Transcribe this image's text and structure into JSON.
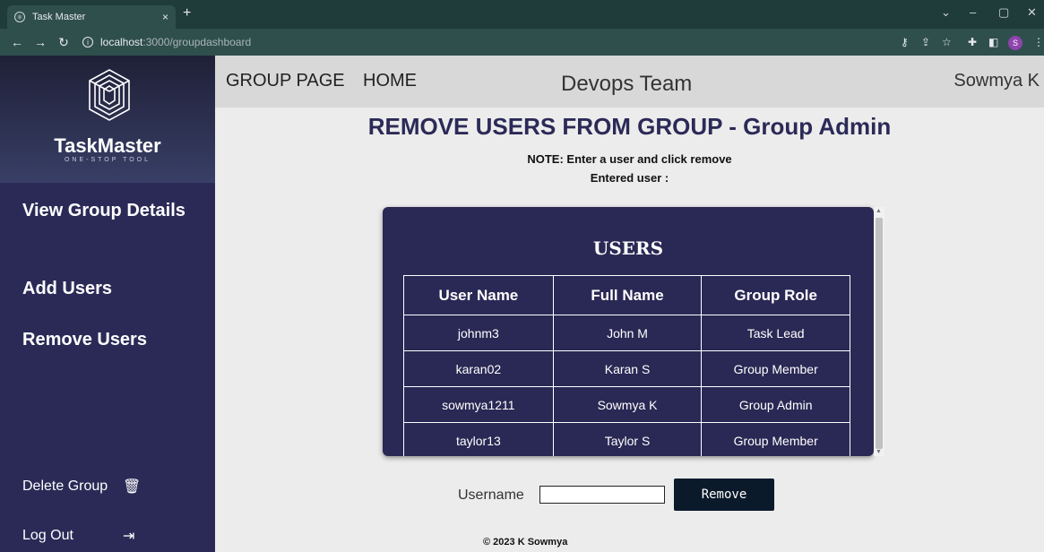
{
  "browser": {
    "tab_title": "Task Master",
    "tab_close": "×",
    "new_tab": "+",
    "url_host": "localhost",
    "url_path": ":3000/groupdashboard",
    "profile_initial": "S"
  },
  "sidebar": {
    "brand_name": "TaskMaster",
    "brand_tagline": "ONE-STOP TOOL",
    "items": [
      {
        "label": "View Group Details"
      },
      {
        "label": "Add Users"
      },
      {
        "label": "Remove Users"
      }
    ],
    "delete_group": "Delete Group",
    "log_out": "Log Out"
  },
  "topnav": {
    "group_page": "GROUP PAGE",
    "home": "HOME",
    "group_name": "Devops Team",
    "user_name": "Sowmya K"
  },
  "main": {
    "title": "REMOVE USERS FROM GROUP - Group Admin",
    "note": "NOTE: Enter a user and click remove",
    "entered_user": "Entered user :"
  },
  "users_table": {
    "title": "USERS",
    "headers": [
      "User Name",
      "Full Name",
      "Group Role"
    ],
    "rows": [
      [
        "johnm3",
        "John M",
        "Task Lead"
      ],
      [
        "karan02",
        "Karan S",
        "Group Member"
      ],
      [
        "sowmya1211",
        "Sowmya K",
        "Group Admin"
      ],
      [
        "taylor13",
        "Taylor S",
        "Group Member"
      ]
    ]
  },
  "form": {
    "username_label": "Username",
    "username_value": "",
    "remove_label": "Remove"
  },
  "footer": "© 2023 K Sowmya"
}
